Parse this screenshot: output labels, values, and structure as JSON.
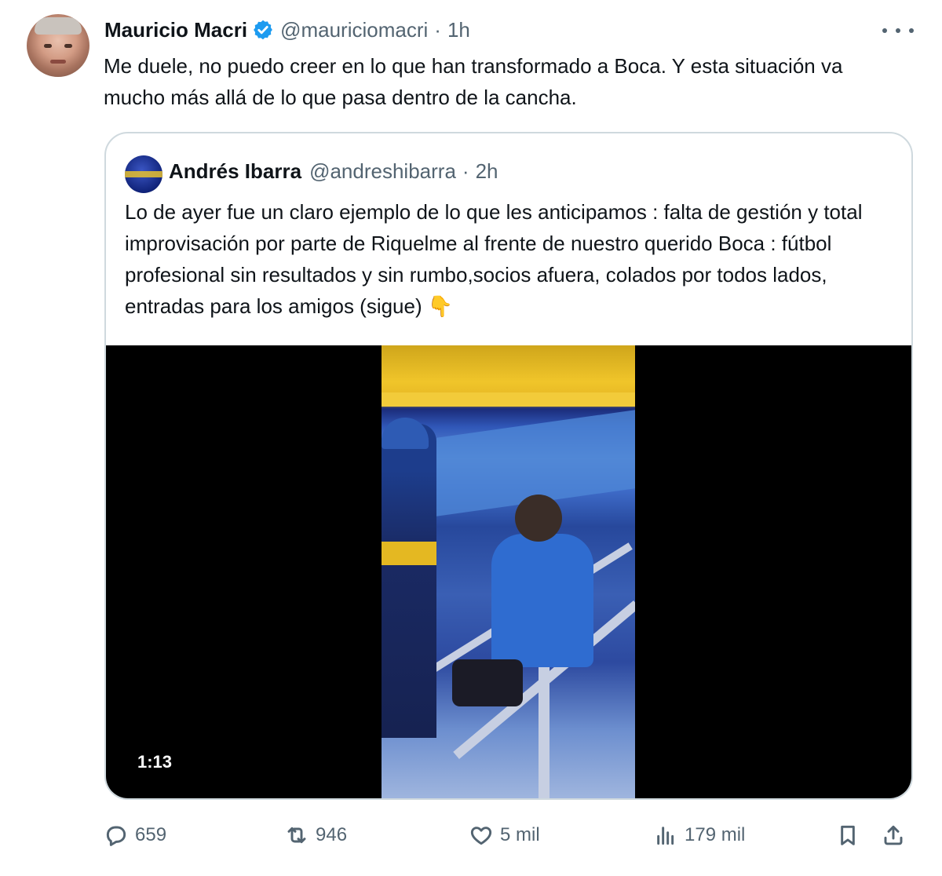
{
  "author": {
    "name": "Mauricio Macri",
    "handle": "@mauriciomacri",
    "separator": "·",
    "time": "1h",
    "text": "Me duele, no puedo creer en lo que han transformado a Boca. Y esta situación va mucho más allá de lo que pasa dentro de la cancha."
  },
  "quoted": {
    "name": "Andrés Ibarra",
    "handle": "@andreshibarra",
    "separator": "·",
    "time": "2h",
    "text": "Lo de ayer fue un claro ejemplo de lo que les anticipamos : falta de gestión y total improvisación por parte de Riquelme al frente de nuestro querido Boca : fútbol profesional sin resultados y sin rumbo,socios afuera, colados por todos lados, entradas para los amigos (sigue)",
    "emoji": "👇",
    "video_duration": "1:13"
  },
  "stats": {
    "replies": "659",
    "reposts": "946",
    "likes": "5 mil",
    "views": "179 mil"
  },
  "colors": {
    "verified": "#1d9bf0",
    "secondary_text": "#536471",
    "border": "#cfd9de"
  },
  "icons": [
    "verified-badge-icon",
    "more-icon",
    "reply-icon",
    "repost-icon",
    "like-icon",
    "views-icon",
    "bookmark-icon",
    "share-icon"
  ]
}
